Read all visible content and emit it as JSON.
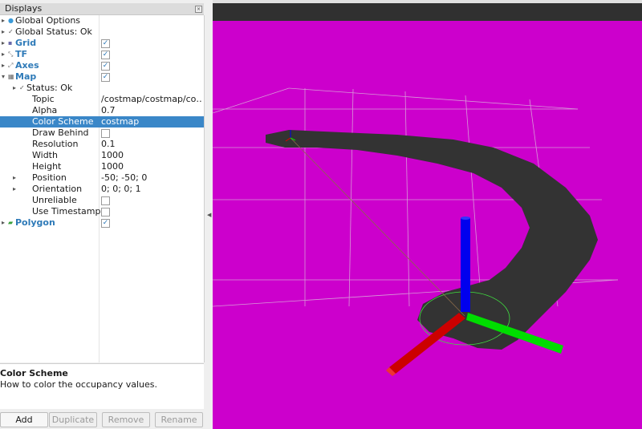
{
  "displays_panel": {
    "title": "Displays",
    "tree": [
      {
        "label": "Global Options",
        "level": 0,
        "arrow": "collapsed",
        "icon": "dot-icon",
        "icon_color": "#3a9ad9"
      },
      {
        "label": "Global Status: Ok",
        "level": 0,
        "arrow": "collapsed",
        "icon": "check-icon"
      },
      {
        "label": "Grid",
        "level": 0,
        "arrow": "collapsed",
        "icon": "grid-icon",
        "bold": true,
        "checked": true
      },
      {
        "label": "TF",
        "level": 0,
        "arrow": "collapsed",
        "icon": "tf-icon",
        "bold": true,
        "checked": true
      },
      {
        "label": "Axes",
        "level": 0,
        "arrow": "collapsed",
        "icon": "axes-icon",
        "bold": true,
        "checked": true
      },
      {
        "label": "Map",
        "level": 0,
        "arrow": "expanded",
        "icon": "map-icon",
        "bold": true,
        "checked": true
      },
      {
        "label": "Status: Ok",
        "level": 1,
        "arrow": "collapsed",
        "icon": "check-icon"
      },
      {
        "label": "Topic",
        "level": 1,
        "value": "/costmap/costmap/co…"
      },
      {
        "label": "Alpha",
        "level": 1,
        "value": "0.7"
      },
      {
        "label": "Color Scheme",
        "level": 1,
        "value": "costmap",
        "selected": true
      },
      {
        "label": "Draw Behind",
        "level": 1,
        "checked": false
      },
      {
        "label": "Resolution",
        "level": 1,
        "value": "0.1"
      },
      {
        "label": "Width",
        "level": 1,
        "value": "1000"
      },
      {
        "label": "Height",
        "level": 1,
        "value": "1000"
      },
      {
        "label": "Position",
        "level": 1,
        "arrow": "collapsed",
        "value": "-50; -50; 0"
      },
      {
        "label": "Orientation",
        "level": 1,
        "arrow": "collapsed",
        "value": "0; 0; 0; 1"
      },
      {
        "label": "Unreliable",
        "level": 1,
        "checked": false
      },
      {
        "label": "Use Timestamp",
        "level": 1,
        "checked": false
      },
      {
        "label": "Polygon",
        "level": 0,
        "arrow": "collapsed",
        "icon": "polygon-icon",
        "bold": true,
        "checked": true
      }
    ],
    "description": {
      "title": "Color Scheme",
      "text": "How to color the occupancy values."
    },
    "buttons": [
      {
        "label": "Add",
        "enabled": true
      },
      {
        "label": "Duplicate",
        "enabled": false
      },
      {
        "label": "Remove",
        "enabled": false
      },
      {
        "label": "Rename",
        "enabled": false
      }
    ]
  },
  "viewport": {
    "background_color": "#cc00cc",
    "sky_color": "#303030",
    "costmap_color": "#333333",
    "grid_color": "#d9a0d9",
    "axis_colors": {
      "x": "#e00000",
      "y": "#00dd00",
      "z": "#0000ee"
    },
    "polygon_color": "#40e040"
  },
  "colors": {
    "selection": "#3a87c8",
    "bold_label": "#2e7ab8"
  }
}
